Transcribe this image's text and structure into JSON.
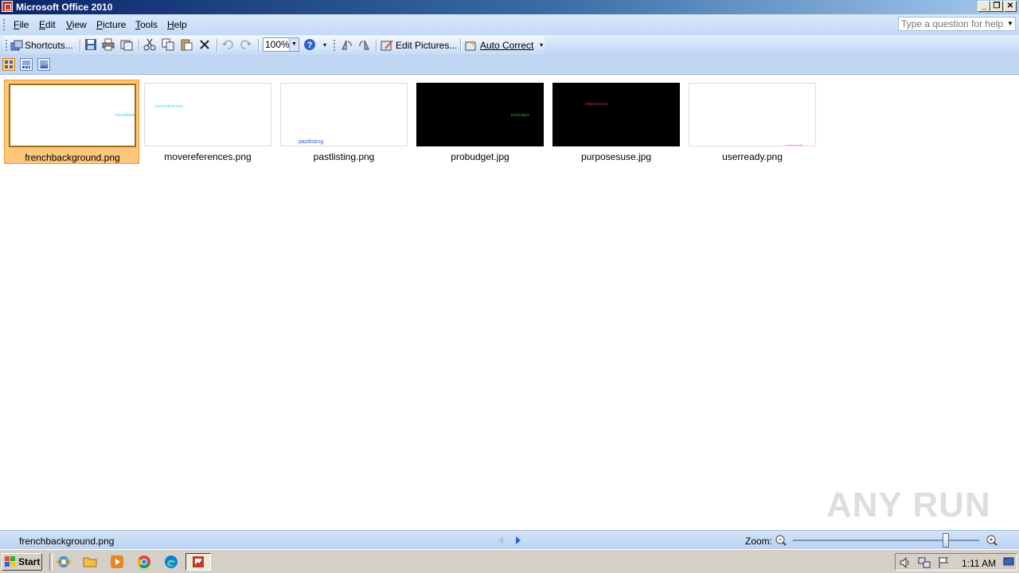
{
  "window": {
    "title": "Microsoft Office 2010",
    "controls": [
      "_",
      "❐",
      "✕"
    ]
  },
  "menu": {
    "items": [
      {
        "label": "File"
      },
      {
        "label": "Edit"
      },
      {
        "label": "View"
      },
      {
        "label": "Picture"
      },
      {
        "label": "Tools"
      },
      {
        "label": "Help"
      }
    ],
    "help_placeholder": "Type a question for help"
  },
  "toolbar": {
    "shortcuts_label": "Shortcuts...",
    "zoom_value": "100%",
    "edit_pictures_label": "Edit Pictures...",
    "auto_correct_label": "Auto Correct"
  },
  "thumbnails": [
    {
      "filename": "frenchbackground.png",
      "bg": "#ffffff",
      "caption": "frenchbackground",
      "caption_color": "#3fd0d0",
      "selected": true
    },
    {
      "filename": "movereferences.png",
      "bg": "#ffffff",
      "caption": "movereferences",
      "caption_color": "#37e0ee",
      "selected": false
    },
    {
      "filename": "pastlisting.png",
      "bg": "#ffffff",
      "caption": "pastlisting",
      "caption_color": "#2f5fd0",
      "selected": false
    },
    {
      "filename": "probudget.jpg",
      "bg": "#000000",
      "caption": "probudget",
      "caption_color": "#2e9a3a",
      "selected": false
    },
    {
      "filename": "purposesuse.jpg",
      "bg": "#000000",
      "caption": "purposesuse",
      "caption_color": "#b03060",
      "selected": false
    },
    {
      "filename": "userready.png",
      "bg": "#ffffff",
      "caption": "userready",
      "caption_color": "#d04060",
      "selected": false
    }
  ],
  "status": {
    "filename": "frenchbackground.png",
    "zoom_label": "Zoom:",
    "zoom_level": 0.82
  },
  "taskbar": {
    "start_label": "Start",
    "clock": "1:11 AM"
  },
  "watermark": "ANY RUN"
}
